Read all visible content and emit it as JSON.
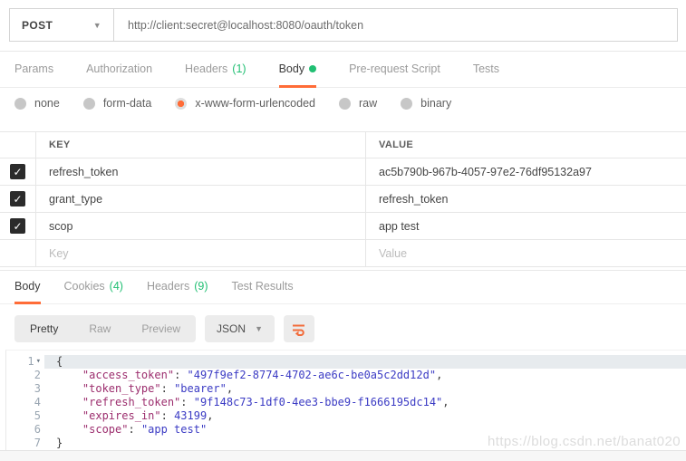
{
  "request": {
    "method": "POST",
    "url": "http://client:secret@localhost:8080/oauth/token",
    "tabs": {
      "params": "Params",
      "authorization": "Authorization",
      "headers": "Headers",
      "headers_count": "(1)",
      "body": "Body",
      "pre_request_script": "Pre-request Script",
      "tests": "Tests",
      "active": "Body"
    },
    "body_modes": {
      "none": "none",
      "form_data": "form-data",
      "urlencoded": "x-www-form-urlencoded",
      "raw": "raw",
      "binary": "binary",
      "selected": "x-www-form-urlencoded"
    },
    "table": {
      "headers": {
        "key": "KEY",
        "value": "VALUE"
      },
      "rows": [
        {
          "checked": true,
          "key": "refresh_token",
          "value": "ac5b790b-967b-4057-97e2-76df95132a97"
        },
        {
          "checked": true,
          "key": "grant_type",
          "value": "refresh_token"
        },
        {
          "checked": true,
          "key": "scop",
          "value": "app test"
        }
      ],
      "placeholder_row": {
        "key": "Key",
        "value": "Value"
      }
    }
  },
  "response": {
    "tabs": {
      "body": "Body",
      "cookies": "Cookies",
      "cookies_count": "(4)",
      "headers": "Headers",
      "headers_count": "(9)",
      "test_results": "Test Results",
      "active": "Body"
    },
    "toolbar": {
      "views": [
        "Pretty",
        "Raw",
        "Preview"
      ],
      "active_view": "Pretty",
      "language": "JSON",
      "wrap_icon": "wrap-lines-icon"
    },
    "body_json": {
      "access_token": "497f9ef2-8774-4702-ae6c-be0a5c2dd12d",
      "token_type": "bearer",
      "refresh_token": "9f148c73-1df0-4ee3-bbe9-f1666195dc14",
      "expires_in": 43199,
      "scope": "app test"
    },
    "code_lines": [
      {
        "n": "1",
        "fold": true,
        "active": true,
        "segments": [
          [
            "plain",
            "{"
          ]
        ]
      },
      {
        "n": "2",
        "segments": [
          [
            "plain",
            "    "
          ],
          [
            "key",
            "\"access_token\""
          ],
          [
            "plain",
            ": "
          ],
          [
            "str",
            "\"497f9ef2-8774-4702-ae6c-be0a5c2dd12d\""
          ],
          [
            "plain",
            ","
          ]
        ]
      },
      {
        "n": "3",
        "segments": [
          [
            "plain",
            "    "
          ],
          [
            "key",
            "\"token_type\""
          ],
          [
            "plain",
            ": "
          ],
          [
            "str",
            "\"bearer\""
          ],
          [
            "plain",
            ","
          ]
        ]
      },
      {
        "n": "4",
        "segments": [
          [
            "plain",
            "    "
          ],
          [
            "key",
            "\"refresh_token\""
          ],
          [
            "plain",
            ": "
          ],
          [
            "str",
            "\"9f148c73-1df0-4ee3-bbe9-f1666195dc14\""
          ],
          [
            "plain",
            ","
          ]
        ]
      },
      {
        "n": "5",
        "segments": [
          [
            "plain",
            "    "
          ],
          [
            "key",
            "\"expires_in\""
          ],
          [
            "plain",
            ": "
          ],
          [
            "num",
            "43199"
          ],
          [
            "plain",
            ","
          ]
        ]
      },
      {
        "n": "6",
        "segments": [
          [
            "plain",
            "    "
          ],
          [
            "key",
            "\"scope\""
          ],
          [
            "plain",
            ": "
          ],
          [
            "str",
            "\"app test\""
          ]
        ]
      },
      {
        "n": "7",
        "segments": [
          [
            "plain",
            "}"
          ]
        ]
      }
    ]
  },
  "watermark": "https://blog.csdn.net/banat020",
  "colors": {
    "accent_orange": "#FF6C37",
    "count_green": "#21BF73",
    "json_key": "#9C2E6E",
    "json_string": "#3B3BC4",
    "json_number": "#3B3BC4"
  }
}
